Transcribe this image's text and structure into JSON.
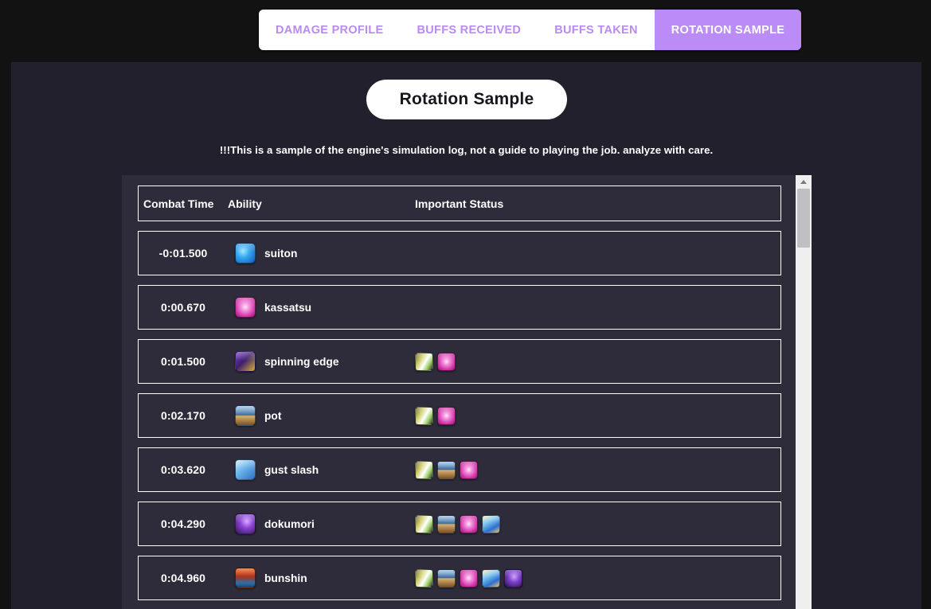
{
  "tabs": [
    {
      "label": "DAMAGE PROFILE",
      "active": false
    },
    {
      "label": "BUFFS RECEIVED",
      "active": false
    },
    {
      "label": "BUFFS TAKEN",
      "active": false
    },
    {
      "label": "ROTATION SAMPLE",
      "active": true
    }
  ],
  "page": {
    "title": "Rotation Sample",
    "warning": "!!!This is a sample of the engine's simulation log, not a guide to playing the job. analyze with care."
  },
  "table": {
    "columns": [
      "Combat Time",
      "Ability",
      "Important Status"
    ],
    "rows": [
      {
        "time": "-0:01.500",
        "ability": "suiton",
        "ability_icon": "suiton-icon",
        "statuses": []
      },
      {
        "time": "0:00.670",
        "ability": "kassatsu",
        "ability_icon": "kassatsu-icon",
        "statuses": []
      },
      {
        "time": "0:01.500",
        "ability": "spinning edge",
        "ability_icon": "spinning-edge-icon",
        "statuses": [
          "status-buff-gold-icon",
          "status-kassatsu-icon"
        ]
      },
      {
        "time": "0:02.170",
        "ability": "pot",
        "ability_icon": "pot-icon",
        "statuses": [
          "status-buff-gold-icon",
          "status-kassatsu-icon"
        ]
      },
      {
        "time": "0:03.620",
        "ability": "gust slash",
        "ability_icon": "gust-slash-icon",
        "statuses": [
          "status-buff-gold-icon",
          "status-pot-icon",
          "status-kassatsu-icon"
        ]
      },
      {
        "time": "0:04.290",
        "ability": "dokumori",
        "ability_icon": "dokumori-icon",
        "statuses": [
          "status-buff-gold-icon",
          "status-pot-icon",
          "status-kassatsu-icon",
          "status-dokumori-icon"
        ]
      },
      {
        "time": "0:04.960",
        "ability": "bunshin",
        "ability_icon": "bunshin-icon",
        "statuses": [
          "status-buff-gold-icon",
          "status-pot-icon",
          "status-kassatsu-icon",
          "status-dokumori-icon",
          "status-bunshin-icon"
        ]
      }
    ]
  },
  "scrollbar": {
    "up_arrow": "scroll-up-arrow",
    "thumb_position_pct": 3
  },
  "colors": {
    "page_background": "#121212",
    "panel_background": "#22202c",
    "table_background": "#2e2c3a",
    "accent_purple": "#bb8cf7",
    "tab_inactive_text": "#b98bf2",
    "tab_bar_background": "#ffffff",
    "row_border": "#ffffff",
    "text_primary": "#ffffff",
    "title_text": "#16161d",
    "scrollbar_track": "#efefef",
    "scrollbar_thumb": "#c0c0c4"
  }
}
